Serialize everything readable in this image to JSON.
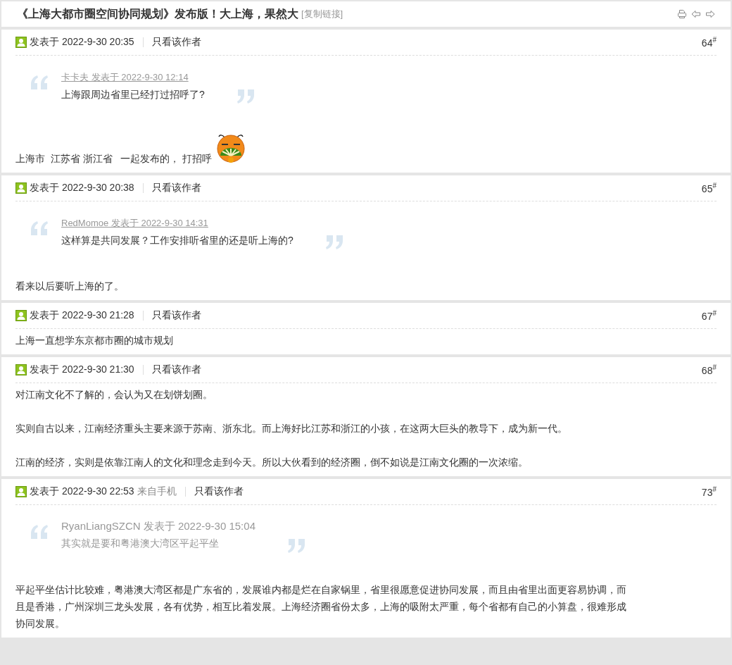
{
  "thread": {
    "title": "《上海大都市圈空间协同规划》发布版！大上海，果然大",
    "copy_link": "[复制链接]"
  },
  "posts": [
    {
      "posted": "发表于 2022-9-30 20:35",
      "author_only": "只看该作者",
      "floor": "64$^{#}$",
      "quote": {
        "author": "卡卡夫 发表于 2022-9-30 12:14",
        "linked": true,
        "text": "上海跟周边省里已经打过招呼了?"
      },
      "body": [
        "上海市  江苏省 浙江省   一起发布的， 打招呼"
      ],
      "emoticon": true
    },
    {
      "posted": "发表于 2022-9-30 20:38",
      "author_only": "只看该作者",
      "floor": "65$^{#}$",
      "quote": {
        "author": "RedMomoe 发表于 2022-9-30 14:31",
        "linked": true,
        "text": "这样算是共同发展？工作安排听省里的还是听上海的?"
      },
      "body": [
        "看来以后要听上海的了。"
      ]
    },
    {
      "posted": "发表于 2022-9-30 21:28",
      "author_only": "只看该作者",
      "floor": "67$^{#}$",
      "body": [
        "上海一直想学东京都市圈的城市规划"
      ]
    },
    {
      "posted": "发表于 2022-9-30 21:30",
      "author_only": "只看该作者",
      "floor": "68$^{#}$",
      "body": [
        "对江南文化不了解的，会认为又在划饼划圈。",
        "实则自古以来，江南经济重头主要来源于苏南、浙东北。而上海好比江苏和浙江的小孩，在这两大巨头的教导下，成为新一代。",
        "江南的经济，实则是依靠江南人的文化和理念走到今天。所以大伙看到的经济圈，倒不如说是江南文化圈的一次浓缩。"
      ]
    },
    {
      "posted": "发表于 2022-9-30 22:53",
      "from_mobile": "来自手机",
      "author_only": "只看该作者",
      "floor": "73$^{#}$",
      "quote": {
        "author": "RyanLiangSZCN 发表于 2022-9-30 15:04",
        "linked": false,
        "text": "其实就是要和粤港澳大湾区平起平坐"
      },
      "body": [
        "平起平坐估计比较难，粤港澳大湾区都是广东省的，发展谁内都是烂在自家锅里，省里很愿意促进协同发展，而且由省里出面更容易协调，而且是香港，广州深圳三龙头发展，各有优势，相互比着发展。上海经济圈省份太多，上海的吸附太严重，每个省都有自己的小算盘，很难形成协同发展。"
      ]
    }
  ]
}
